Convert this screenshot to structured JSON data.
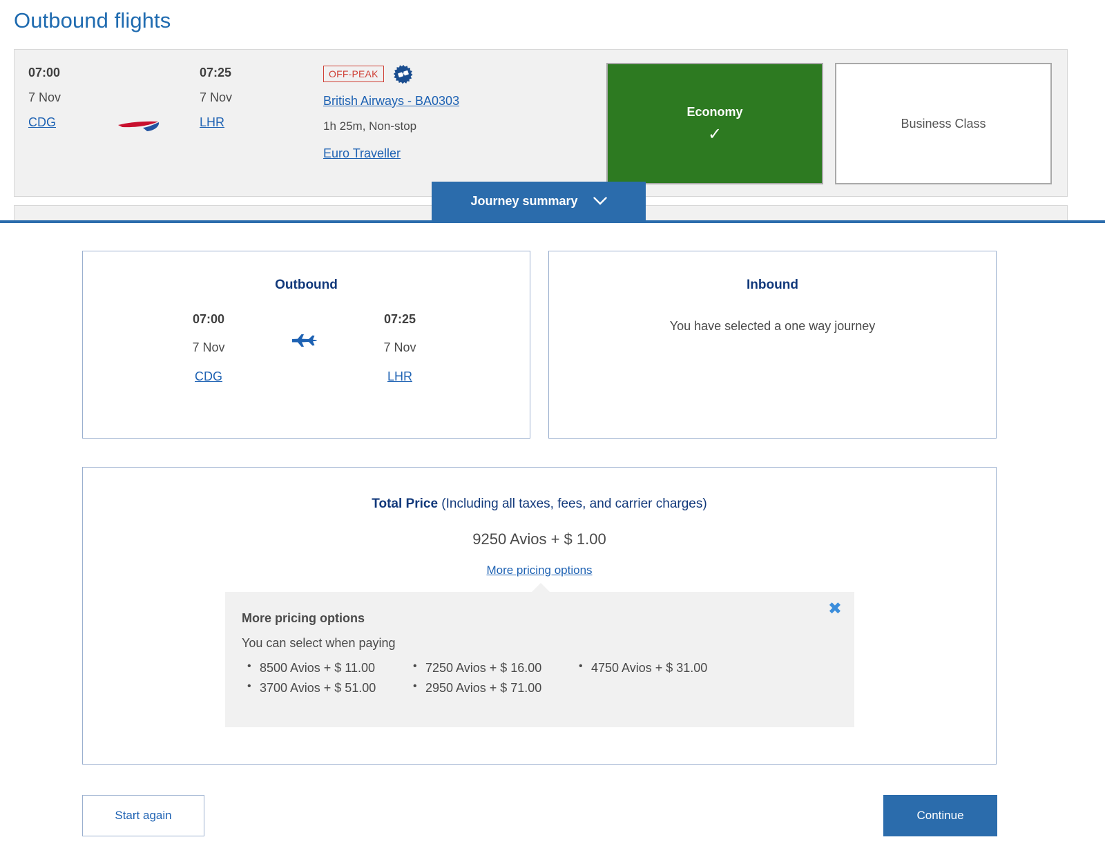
{
  "page": {
    "title": "Outbound flights"
  },
  "colors": {
    "title_blue": "#1f6bb0",
    "link_blue": "#1e62b3",
    "brand_blue": "#2b6cac",
    "heading_navy": "#12397b",
    "selected_green": "#2d7a21",
    "offpeak_red": "#cf4036",
    "card_border": "#9bb0cf",
    "panel_grey": "#f1f1f1"
  },
  "flight": {
    "depart": {
      "time": "07:00",
      "date": "7 Nov",
      "airport": "CDG"
    },
    "arrive": {
      "time": "07:25",
      "date": "7 Nov",
      "airport": "LHR"
    },
    "airline_logo_icon": "british-airways-speedmarque-icon",
    "fare_badge": "OFF-PEAK",
    "reward_icon": "rosette-badge-icon",
    "flight_link": "British Airways - BA0303",
    "duration": "1h 25m, Non-stop",
    "cabin_link": "Euro Traveller",
    "cabins": [
      {
        "label": "Economy",
        "selected": true,
        "check_icon": "check-icon"
      },
      {
        "label": "Business Class",
        "selected": false
      }
    ]
  },
  "journey_tab": {
    "label": "Journey summary",
    "chevron_icon": "chevron-down-icon"
  },
  "summary": {
    "outbound": {
      "title": "Outbound",
      "plane_icon": "airplane-icon",
      "depart": {
        "time": "07:00",
        "date": "7 Nov",
        "airport": "CDG"
      },
      "arrive": {
        "time": "07:25",
        "date": "7 Nov",
        "airport": "LHR"
      }
    },
    "inbound": {
      "title": "Inbound",
      "note": "You have selected a one way journey"
    }
  },
  "price": {
    "heading_bold": "Total Price",
    "heading_rest": " (Including all taxes, fees, and carrier charges)",
    "amount": "9250 Avios + $ 1.00",
    "more_link": "More pricing options",
    "popup": {
      "title": "More pricing options",
      "subtitle": "You can select when paying",
      "close_icon": "close-icon",
      "options": [
        "8500 Avios + $ 11.00",
        "7250 Avios + $ 16.00",
        "4750 Avios + $ 31.00",
        "3700 Avios + $ 51.00",
        "2950 Avios + $ 71.00"
      ]
    }
  },
  "footer": {
    "start_again": "Start again",
    "continue": "Continue"
  }
}
